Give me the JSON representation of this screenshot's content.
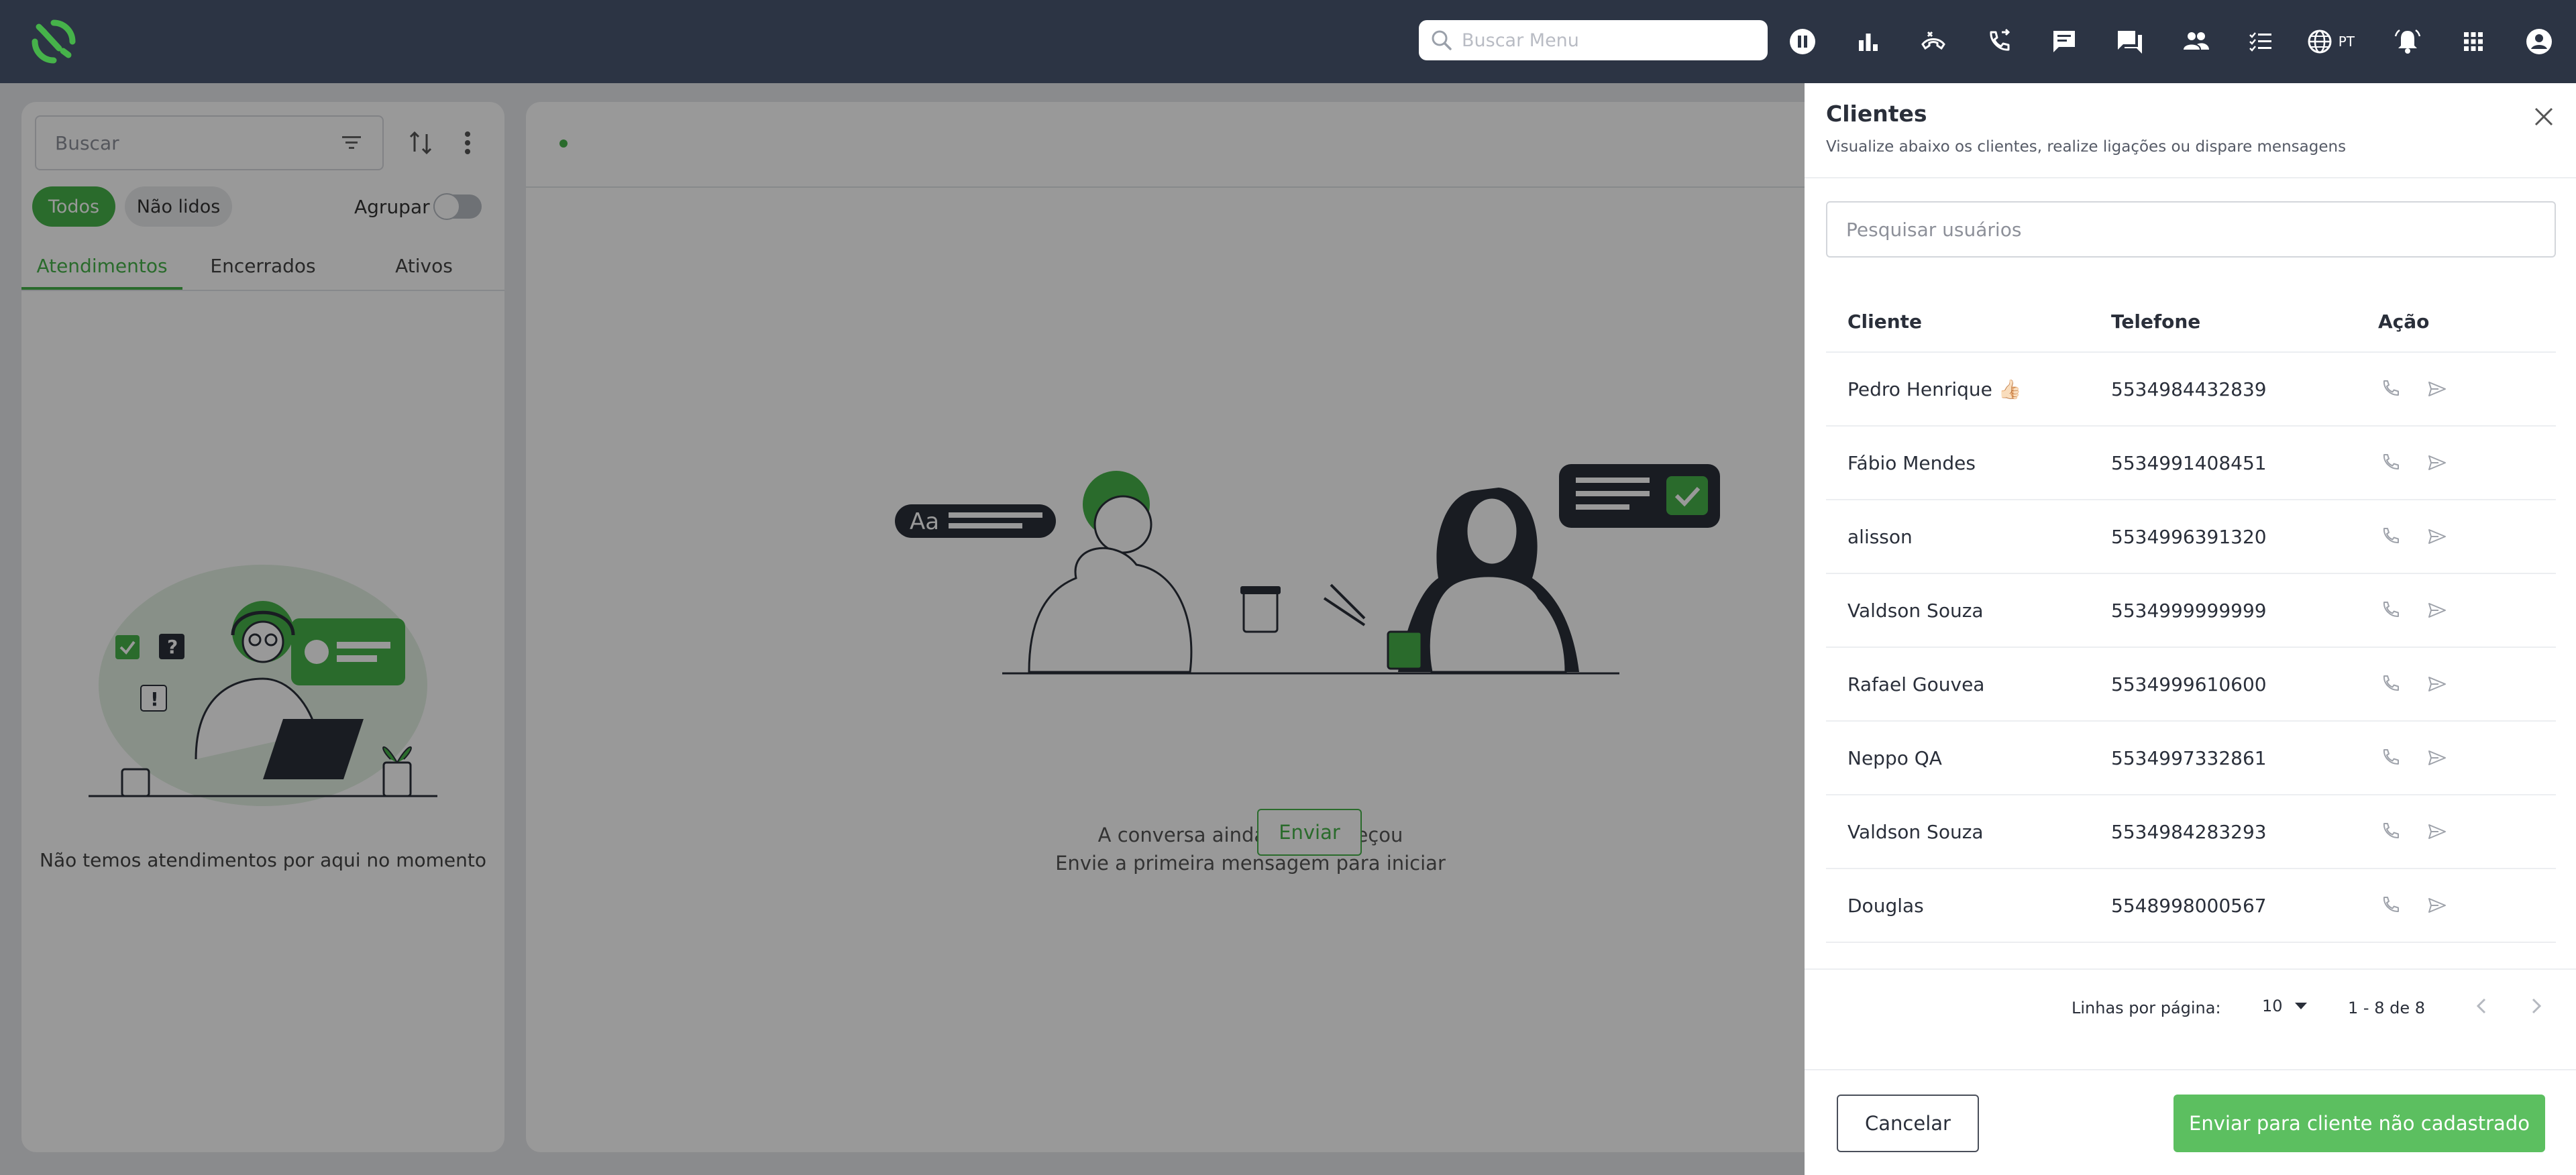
{
  "topbar": {
    "search_placeholder": "Buscar Menu",
    "language": "PT",
    "icons": [
      "pause-icon",
      "chart-icon",
      "call-end-icon",
      "phone-forward-icon",
      "message-icon",
      "forum-icon",
      "people-icon",
      "list-icon",
      "globe-icon",
      "bell-icon",
      "apps-icon",
      "account-icon"
    ]
  },
  "left_panel": {
    "search_placeholder": "Buscar",
    "filters": {
      "all": "Todos",
      "unread": "Não lidos"
    },
    "group_label": "Agrupar",
    "tabs": [
      "Atendimentos",
      "Encerrados",
      "Ativos"
    ],
    "empty_message": "Não temos atendimentos por aqui no momento"
  },
  "main": {
    "empty_line1": "A conversa ainda não começou",
    "empty_line2": "Envie a primeira mensagem para iniciar",
    "send_label": "Enviar",
    "bubble_text": "Aa"
  },
  "drawer": {
    "title": "Clientes",
    "subtitle": "Visualize abaixo os clientes, realize ligações ou dispare mensagens",
    "search_placeholder": "Pesquisar usuários",
    "columns": {
      "client": "Cliente",
      "phone": "Telefone",
      "action": "Ação"
    },
    "rows": [
      {
        "name": "Pedro Henrique 👍🏻",
        "phone": "5534984432839"
      },
      {
        "name": "Fábio Mendes",
        "phone": "5534991408451"
      },
      {
        "name": "alisson",
        "phone": "5534996391320"
      },
      {
        "name": "Valdson Souza",
        "phone": "5534999999999"
      },
      {
        "name": "Rafael Gouvea",
        "phone": "5534999610600"
      },
      {
        "name": "Neppo QA",
        "phone": "5534997332861"
      },
      {
        "name": "Valdson Souza",
        "phone": "5534984283293"
      },
      {
        "name": "Douglas",
        "phone": "5548998000567"
      }
    ],
    "pagination": {
      "rows_per_page_label": "Linhas por página:",
      "rows_per_page": "10",
      "range": "1 - 8 de 8"
    },
    "cancel_label": "Cancelar",
    "send_unregistered_label": "Enviar para cliente não cadastrado"
  },
  "colors": {
    "topbar": "#2c3444",
    "accent": "#46b24a",
    "overlay": "rgba(0,0,0,0.40)"
  }
}
